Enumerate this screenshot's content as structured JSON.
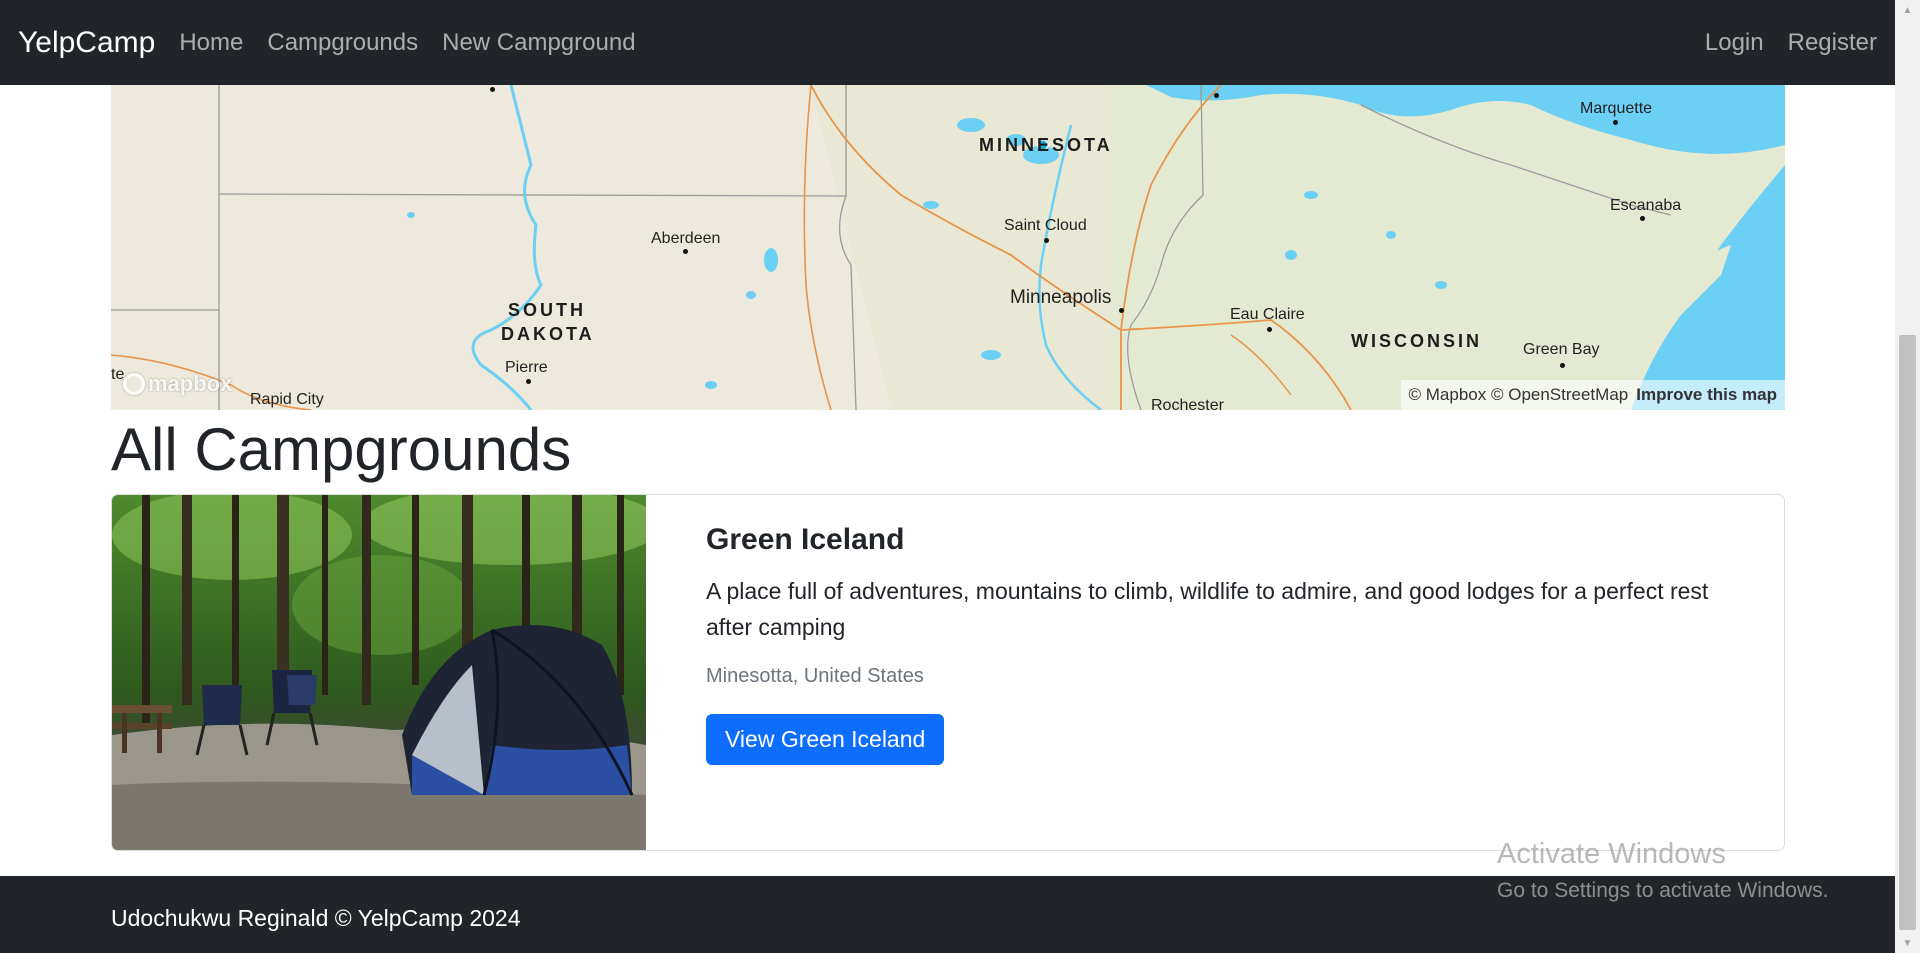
{
  "navbar": {
    "brand": "YelpCamp",
    "links": [
      "Home",
      "Campgrounds",
      "New Campground"
    ],
    "right_links": [
      "Login",
      "Register"
    ]
  },
  "map": {
    "state_labels": [
      "MINNESOTA",
      "SOUTH",
      "DAKOTA",
      "WISCONSIN"
    ],
    "city_labels": [
      "Marquette",
      "Escanaba",
      "Saint Cloud",
      "Aberdeen",
      "Minneapolis",
      "Eau Claire",
      "Green Bay",
      "Pierre",
      "Rapid City",
      "Rochester",
      "te"
    ],
    "logo": "mapbox",
    "attribution": "© Mapbox © OpenStreetMap",
    "improve_link": "Improve this map",
    "colors": {
      "land": "#ede9dc",
      "water": "#6ccff4",
      "road": "#e8944a",
      "border": "#9a9a9a"
    }
  },
  "page": {
    "title": "All Campgrounds"
  },
  "campgrounds": [
    {
      "title": "Green Iceland",
      "description": "A place full of adventures, mountains to climb, wildlife to admire, and good lodges for a perfect rest after camping",
      "location": "Minesotta, United States",
      "button_label": "View Green Iceland"
    }
  ],
  "footer": {
    "text": "Udochukwu Reginald © YelpCamp 2024"
  },
  "watermark": {
    "title": "Activate Windows",
    "subtitle": "Go to Settings to activate Windows."
  },
  "colors": {
    "navbar_bg": "#212529",
    "primary_button": "#0d6efd",
    "muted_text": "#6c757d"
  }
}
